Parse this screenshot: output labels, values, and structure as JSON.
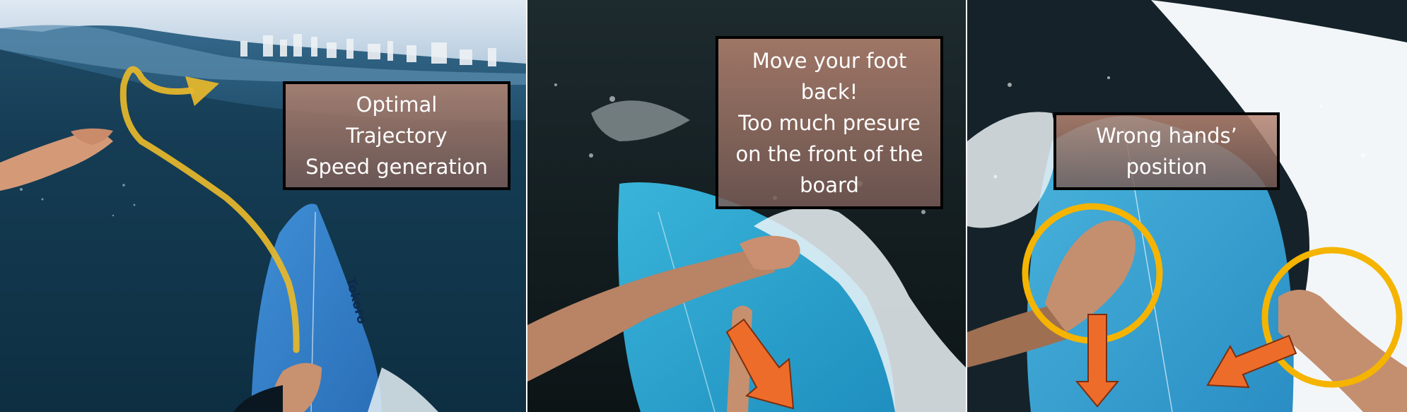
{
  "panels": [
    {
      "caption_lines": [
        "Optimal",
        "Trajectory",
        "Speed generation"
      ],
      "board_logo": "Tokoro",
      "annotation_color": "#e8b82a"
    },
    {
      "caption_lines": [
        "Move your foot",
        "back!",
        "Too much presure",
        "on the front of the",
        "board"
      ],
      "arrow_color": "#ee6c2a"
    },
    {
      "caption_lines": [
        "Wrong hands’",
        "position"
      ],
      "circle_color": "#f5b400",
      "arrow_color": "#ee6c2a"
    }
  ],
  "icons": [
    "trajectory-arrow-icon",
    "down-arrow-icon",
    "highlight-circle-icon"
  ]
}
